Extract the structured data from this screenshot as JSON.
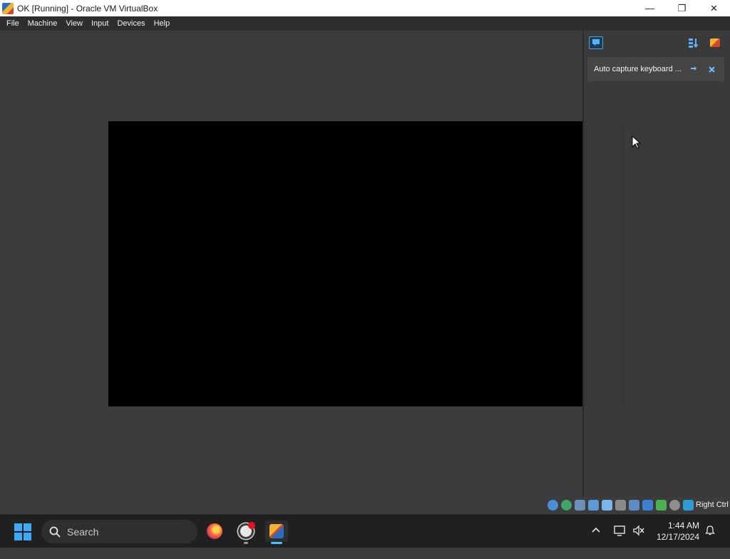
{
  "window": {
    "title": "OK [Running] - Oracle VM VirtualBox",
    "controls": {
      "minimize": "—",
      "restore": "❐",
      "close": "✕"
    }
  },
  "menu": {
    "items": [
      "File",
      "Machine",
      "View",
      "Input",
      "Devices",
      "Help"
    ]
  },
  "notification_panel": {
    "icons": [
      "notification-center-icon",
      "sort-icon",
      "virtualbox-icon"
    ],
    "notices": [
      {
        "text": "Auto capture keyboard ...",
        "actions": [
          "more-icon",
          "close-icon"
        ]
      }
    ]
  },
  "statusbar": {
    "icons": [
      "optical-drive-icon",
      "network-icon",
      "usb-icon",
      "shared-folders-icon",
      "display-icon",
      "recording-icon",
      "cpu-icon",
      "video-capture-icon",
      "keyboard-icon",
      "mouse-integration-icon"
    ],
    "host_key": "Right Ctrl"
  },
  "taskbar": {
    "search_placeholder": "Search",
    "apps": [
      "firefox",
      "obs-studio",
      "virtualbox"
    ],
    "time": "1:44 AM",
    "date": "12/17/2024"
  },
  "colors": {
    "vm_background": "#3c3c3c",
    "vm_screen": "#000000",
    "accent": "#4cc2ff"
  }
}
